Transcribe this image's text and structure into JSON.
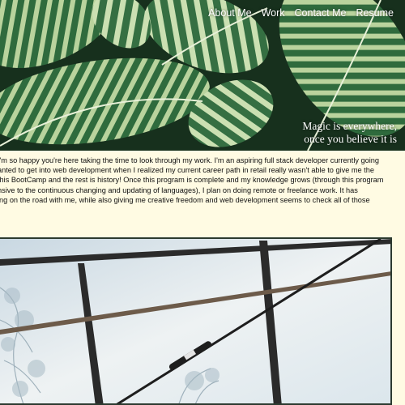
{
  "nav": {
    "items": [
      "About Me",
      "Work",
      "Contact Me",
      "Resume"
    ]
  },
  "hero": {
    "tagline_line1": "Magic is everywhere,",
    "tagline_line2": "once you believe it is"
  },
  "intro": {
    "lines": [
      "I'm so happy you're here taking the time to look through my work. I'm an aspiring full stack developer currently going",
      "anted to get into web development when I realized my current career path in retail really wasn't able to give me the",
      "this BootCamp and the rest is history! Once this program is complete and my knowledge grows (through this program",
      "nsive to the continuous changing and updating of languages), I plan on doing remote or freelance work. It has",
      "ing on the road with me, while also giving me creative freedom and web development seems to check all of those",
      "."
    ]
  },
  "colors": {
    "page_background": "#fffbe3",
    "leaf_dark": "#2f6b3d",
    "leaf_light": "#c9ddb0"
  }
}
